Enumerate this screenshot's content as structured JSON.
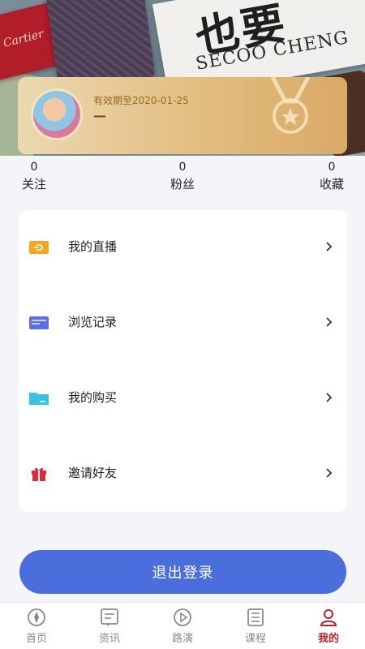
{
  "header": {
    "book_title": "也要",
    "book_subtitle": "SECOO CHENG",
    "card_brand": "Cartier"
  },
  "member": {
    "valid_text": "有效期至2020-01-25",
    "name": "—"
  },
  "stats": [
    {
      "count": "0",
      "label": "关注"
    },
    {
      "count": "0",
      "label": "粉丝"
    },
    {
      "count": "0",
      "label": "收藏"
    }
  ],
  "menu": [
    {
      "label": "我的直播",
      "icon": "live-icon",
      "color": "#f5a623"
    },
    {
      "label": "浏览记录",
      "icon": "history-icon",
      "color": "#5b6ee8"
    },
    {
      "label": "我的购买",
      "icon": "folder-icon",
      "color": "#35c3e0"
    },
    {
      "label": "邀请好友",
      "icon": "gift-icon",
      "color": "#e0283a"
    }
  ],
  "logout_label": "退出登录",
  "tabs": [
    {
      "label": "首页",
      "icon": "home-icon",
      "active": false
    },
    {
      "label": "资讯",
      "icon": "news-icon",
      "active": false
    },
    {
      "label": "路演",
      "icon": "play-icon",
      "active": false
    },
    {
      "label": "课程",
      "icon": "course-icon",
      "active": false
    },
    {
      "label": "我的",
      "icon": "user-icon",
      "active": true
    }
  ],
  "colors": {
    "accent": "#4a6fdc",
    "active_tab": "#c0202a",
    "gold": "#e2bd80"
  }
}
